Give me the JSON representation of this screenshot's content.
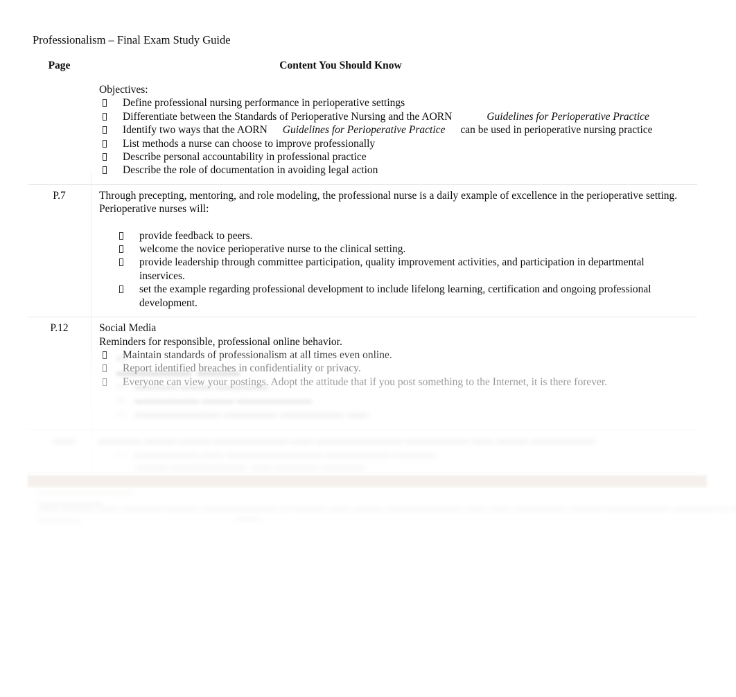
{
  "document": {
    "title": "Professionalism – Final Exam Study Guide"
  },
  "table": {
    "headers": {
      "page": "Page",
      "content": "Content You Should Know"
    },
    "rows": [
      {
        "page": "",
        "lead": "Objectives:",
        "bullets": [
          "Define professional nursing performance in perioperative settings",
          "Differentiate between the Standards of Perioperative Nursing and the AORN Guidelines for Perioperative Practice",
          "Identify two ways that the AORN Guidelines for Perioperative Practice can be used in perioperative nursing practice",
          "List methods a nurse can choose to improve professionally",
          "Describe personal accountability in professional practice",
          "Describe the role of documentation in avoiding legal action"
        ]
      },
      {
        "page": "P.7",
        "lead": "Through precepting, mentoring, and role modeling, the professional nurse is a daily example of excellence in the perioperative setting. Perioperative nurses will:",
        "bullets": [
          "provide feedback to peers.",
          "welcome the novice perioperative nurse to the clinical setting.",
          "provide leadership through committee participation, quality improvement activities, and participation in departmental inservices.",
          "set the example regarding professional development to include lifelong learning, certification and ongoing professional development."
        ]
      },
      {
        "page": "P.12",
        "lead": "Social Media",
        "lead2": "Reminders for responsible, professional online behavior.",
        "bullets": [
          "Maintain standards of professionalism at all times even online.",
          "Report identified breaches in confidentiality or privacy.",
          "Everyone can view your postings. Adopt the attitude that if you post something to the Internet, it is there forever."
        ]
      }
    ]
  },
  "objective_fragments": {
    "bullet2_main": "Differentiate between the Standards of Perioperative Nursing and the AORN",
    "bullet2_title": "Guidelines for Perioperative Practice",
    "bullet3_main": "Identify two ways that the AORN",
    "bullet3_title": "Guidelines for Perioperative Practice",
    "bullet3_tail": "can be used in perioperative nursing practice"
  },
  "obscured": {
    "note": "Content below this point is faded/blurred and not legible in the source image.",
    "accent_bar_color": "#c9ab94",
    "header_band_color": "#d2d2d2"
  }
}
